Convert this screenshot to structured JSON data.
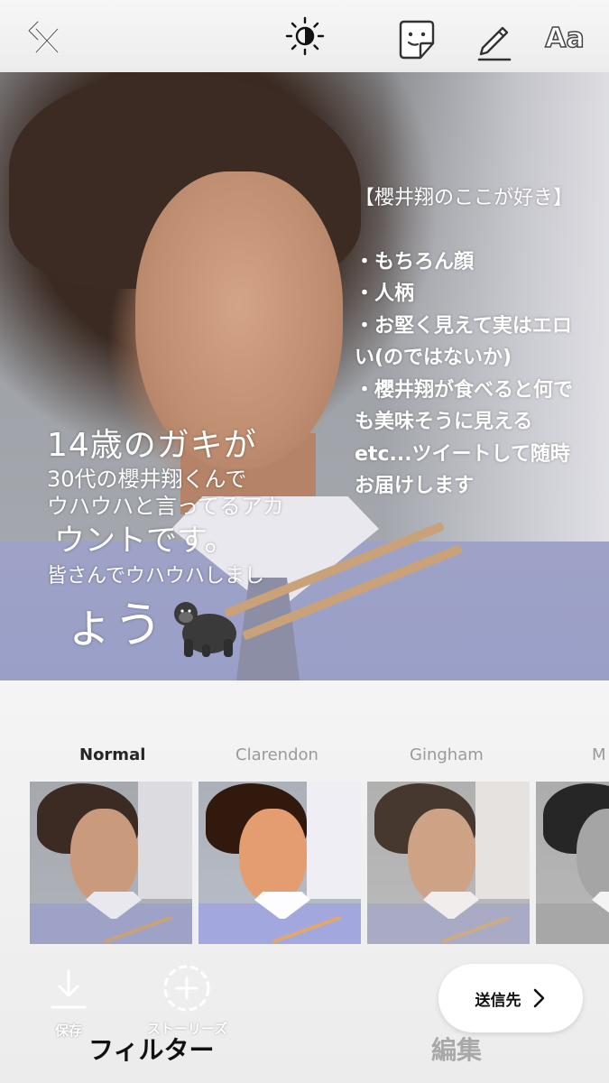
{
  "toolbar": {
    "back_icon": "back-close-icon",
    "brightness_icon": "brightness-icon",
    "sticker_icon": "sticker-icon",
    "draw_icon": "pen-icon",
    "text_label": "Aa"
  },
  "overlay": {
    "left_lines": [
      "14歳のガキが",
      "30代の櫻井翔くんで",
      "ウハウハと言ってるアカ",
      "ウントです。",
      "皆さんでウハウハしまし",
      "ょう"
    ],
    "left_emoji": "gorilla-icon",
    "right_heading": "【櫻井翔のここが好き】",
    "right_lines": [
      "・もちろん顔",
      "・人柄",
      "・お堅く見えて実はエロ",
      "い(のではないか)",
      "・櫻井翔が食べると何で",
      "も美味そうに見える",
      "etc...ツイートして随時",
      "お届けします"
    ]
  },
  "filters": {
    "items": [
      {
        "label": "Normal",
        "active": true
      },
      {
        "label": "Clarendon",
        "active": false
      },
      {
        "label": "Gingham",
        "active": false
      },
      {
        "label": "M",
        "active": false
      }
    ]
  },
  "actions": {
    "save_label": "保存",
    "story_label": "ストーリーズ",
    "send_label": "送信先"
  },
  "tabs": {
    "filter_label": "フィルター",
    "edit_label": "編集"
  }
}
